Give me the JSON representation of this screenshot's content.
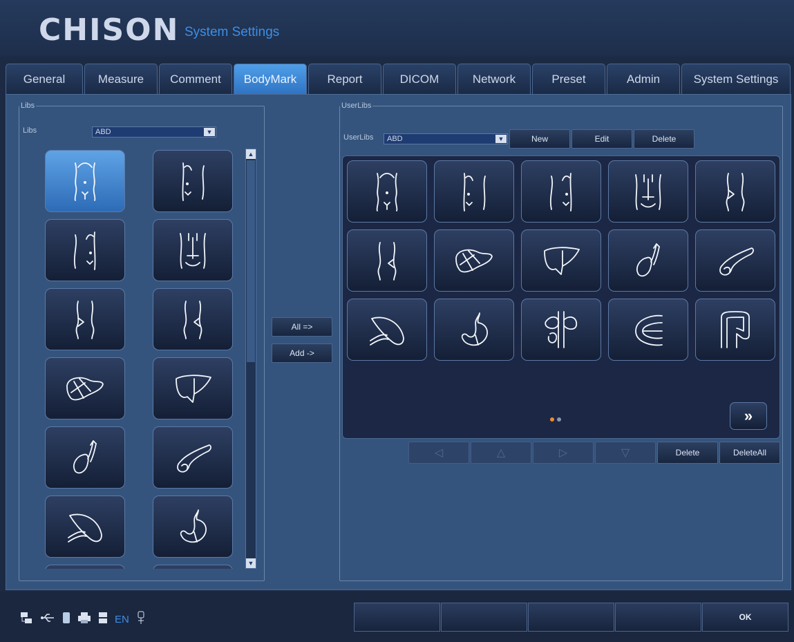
{
  "app": {
    "brand": "CHISON",
    "window_title": "System Settings"
  },
  "tabs": [
    {
      "label": "General"
    },
    {
      "label": "Measure"
    },
    {
      "label": "Comment"
    },
    {
      "label": "BodyMark",
      "active": true
    },
    {
      "label": "Report"
    },
    {
      "label": "DICOM"
    },
    {
      "label": "Network"
    },
    {
      "label": "Preset"
    },
    {
      "label": "Admin"
    },
    {
      "label": "System Settings"
    }
  ],
  "libs": {
    "group_label": "Libs",
    "field_label": "Libs",
    "selected": "ABD",
    "items": [
      "abdomen-front-icon",
      "abdomen-right-icon",
      "abdomen-left-icon",
      "abdomen-muscle-icon",
      "flank-left-icon",
      "flank-right-icon",
      "liver-icon",
      "liver-outline-icon",
      "gallbladder-icon",
      "pancreas-icon",
      "spleen-icon",
      "stomach-icon"
    ],
    "selected_index": 0
  },
  "transfer": {
    "all_label": "All =>",
    "add_label": "Add ->"
  },
  "userlibs": {
    "group_label": "UserLibs",
    "field_label": "UserLibs",
    "selected": "ABD",
    "new_label": "New",
    "edit_label": "Edit",
    "delete_label": "Delete",
    "items": [
      "abdomen-front-icon",
      "abdomen-right-icon",
      "abdomen-left-icon",
      "abdomen-muscle-icon",
      "flank-left-icon",
      "flank-right-icon",
      "liver-icon",
      "liver-outline-icon",
      "gallbladder-icon",
      "pancreas-icon",
      "spleen-icon",
      "stomach-icon",
      "kidney-vessel-icon",
      "bladder-icon",
      "colon-icon"
    ],
    "page_dots": 2,
    "current_page": 1,
    "next_label": "»"
  },
  "order_controls": {
    "left_label": "◁",
    "up_label": "△",
    "right_label": "▷",
    "down_label": "▽",
    "delete_label": "Delete",
    "delete_all_label": "DeleteAll"
  },
  "footer": {
    "language": "EN",
    "status_icons": [
      "network-icon",
      "usb-icon",
      "storage-icon",
      "printer-icon",
      "disk-icon",
      "language-indicator",
      "probe-icon"
    ],
    "softkeys": [
      "",
      "",
      "",
      "",
      "OK"
    ]
  },
  "colors": {
    "accent": "#3d8ee6",
    "active_tab": "#4f9fe8",
    "panel": "#34547d",
    "header": "#1f3050",
    "page_dot_active": "#f08b2c"
  }
}
